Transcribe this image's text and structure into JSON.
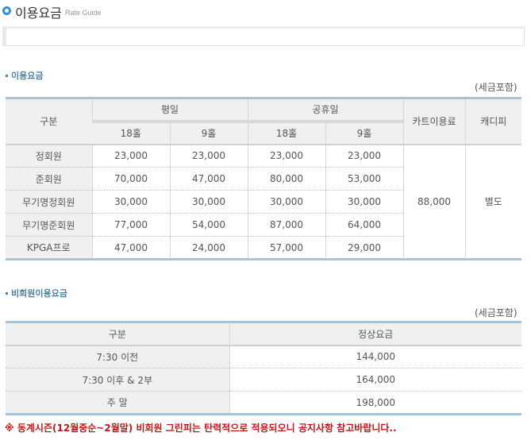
{
  "header": {
    "title": "이용요금",
    "subtitle": "Rate Guide"
  },
  "rate_section": {
    "title": "이용요금",
    "tax_note": "(세금포함)",
    "headers": {
      "category": "구분",
      "weekday": "평일",
      "holiday": "공휴일",
      "cart": "카트이용료",
      "caddie": "캐디피",
      "h18": "18홀",
      "h9": "9홀"
    },
    "rows": [
      {
        "label": "정회원",
        "weekday_18": "23,000",
        "weekday_9": "23,000",
        "holiday_18": "23,000",
        "holiday_9": "23,000"
      },
      {
        "label": "준회원",
        "weekday_18": "70,000",
        "weekday_9": "47,000",
        "holiday_18": "80,000",
        "holiday_9": "53,000"
      },
      {
        "label": "무기명정회원",
        "weekday_18": "30,000",
        "weekday_9": "30,000",
        "holiday_18": "30,000",
        "holiday_9": "30,000"
      },
      {
        "label": "무기명준회원",
        "weekday_18": "77,000",
        "weekday_9": "54,000",
        "holiday_18": "87,000",
        "holiday_9": "64,000"
      },
      {
        "label": "KPGA프로",
        "weekday_18": "47,000",
        "weekday_9": "24,000",
        "holiday_18": "57,000",
        "holiday_9": "29,000"
      }
    ],
    "cart_fee": "88,000",
    "caddie_fee": "별도"
  },
  "nonmember_section": {
    "title": "비회원이용요금",
    "tax_note": "(세금포함)",
    "headers": {
      "category": "구분",
      "regular": "정상요금"
    },
    "rows": [
      {
        "label": "7:30 이전",
        "price": "144,000"
      },
      {
        "label": "7:30 이후 & 2부",
        "price": "164,000"
      },
      {
        "label": "주 말",
        "price": "198,000"
      }
    ]
  },
  "footnote": "※ 동계시즌(12월중순~2월말) 비회원 그린피는 탄력적으로 적용되오니 공지사항 참고바랍니다..",
  "colors": {
    "accent": "#3a8fd0",
    "section_title": "#4a7fa8",
    "table_border": "#a9c4d6",
    "header_bg": "#f0f0f0",
    "footnote": "#c01818"
  }
}
